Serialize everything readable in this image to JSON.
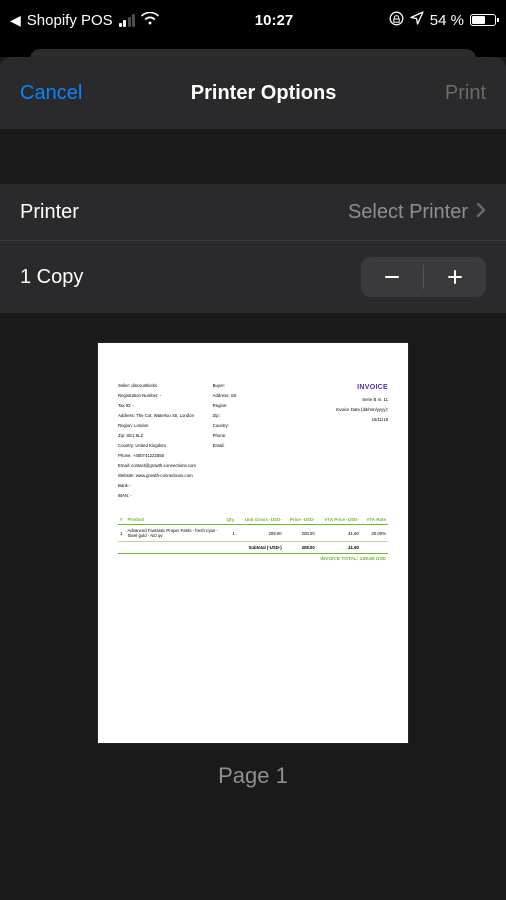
{
  "status_bar": {
    "back_app": "Shopify POS",
    "time": "10:27",
    "battery_text": "54 %",
    "battery_pct": 54
  },
  "nav": {
    "cancel": "Cancel",
    "title": "Printer Options",
    "print": "Print"
  },
  "rows": {
    "printer_label": "Printer",
    "printer_value": "Select Printer",
    "copies_label": "1 Copy"
  },
  "preview": {
    "page_label": "Page 1"
  },
  "invoice": {
    "heading": "INVOICE",
    "meta_serie": "Serie B nr. 11",
    "meta_date_label": "Invoice Date (dd/mm/yyyy):",
    "meta_date": "19/11/19",
    "seller": {
      "seller": "Seller: discountkicks",
      "reg": "Registration Number: -",
      "tax": "Tax ID: -",
      "addr": "Address: The Cut, Waterloo Str, London",
      "region": "Region: London",
      "zip": "Zip: SE1 8LZ",
      "country": "Country: United Kingdom",
      "phone": "Phone: +460741222556",
      "email": "Email: contact@growth-connections.com",
      "website": "Website: www.growth-connections.com",
      "bank": "Bank: -",
      "iban": "IBAN: -"
    },
    "buyer": {
      "buyer": "Buyer:",
      "addr": "Address: Str.",
      "region": "Region:",
      "zip": "Zip:",
      "country": "Country:",
      "phone": "Phone:",
      "email": "Email:"
    },
    "table": {
      "headers": {
        "num": "#",
        "product": "Product",
        "qty": "Qty.",
        "unit_gross": "Unit Gross -USD-",
        "price": "Price -USD-",
        "vta_price": "VTA Price -USD-",
        "vta_rate": "VTA Rate"
      },
      "row": {
        "num": "1",
        "product": "Advanced Fantastic Proper Pants - fresh cyan - Steel gold - NO qv",
        "qty": "1",
        "unit_gross": "208.00",
        "price": "208.00",
        "vta_price": "41.60",
        "vta_rate": "20.00%"
      },
      "subtotal_label": "Subtotal (-USD-)",
      "subtotal_price": "208.00",
      "subtotal_vta": "41.60",
      "total_label": "INVOICE TOTAL: 249.60 USD"
    }
  }
}
